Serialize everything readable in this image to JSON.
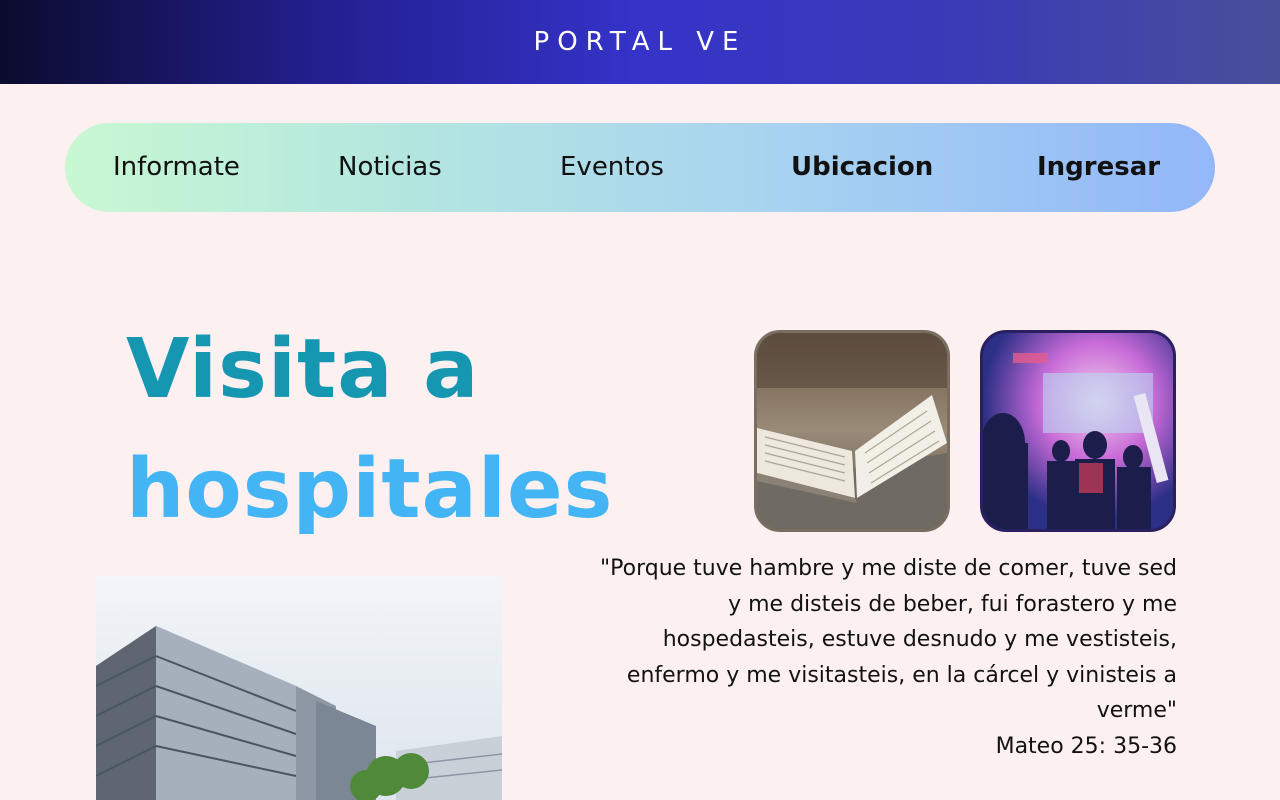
{
  "header": {
    "brand": "PORTAL VE"
  },
  "nav": {
    "items": [
      {
        "label": "Informate"
      },
      {
        "label": "Noticias"
      },
      {
        "label": "Eventos"
      },
      {
        "label": "Ubicacion"
      },
      {
        "label": "Ingresar"
      }
    ]
  },
  "hero": {
    "title_line1": "Visita a",
    "title_line2": "hospitales",
    "colors": {
      "title_line1": "#1597b2",
      "title_line2": "#43b4f4"
    }
  },
  "quote": {
    "text": "\"Porque tuve hambre y me diste de comer, tuve sed y me disteis de beber, fui forastero y me hospedasteis, estuve desnudo y me vestisteis, enfermo y me visitasteis, en la cárcel y vinisteis a verme\"",
    "reference": "Mateo 25: 35-36"
  },
  "images": {
    "bible": "open-bible-photo",
    "worship": "worship-service-photo",
    "hospital": "hospital-building-photo"
  },
  "colors": {
    "header_gradient": [
      "#0b0b2e",
      "#3533c9",
      "#4a4f9a"
    ],
    "nav_gradient": [
      "#c8f8d2",
      "#93b7f9"
    ],
    "page_background": "#fdf0f1"
  }
}
